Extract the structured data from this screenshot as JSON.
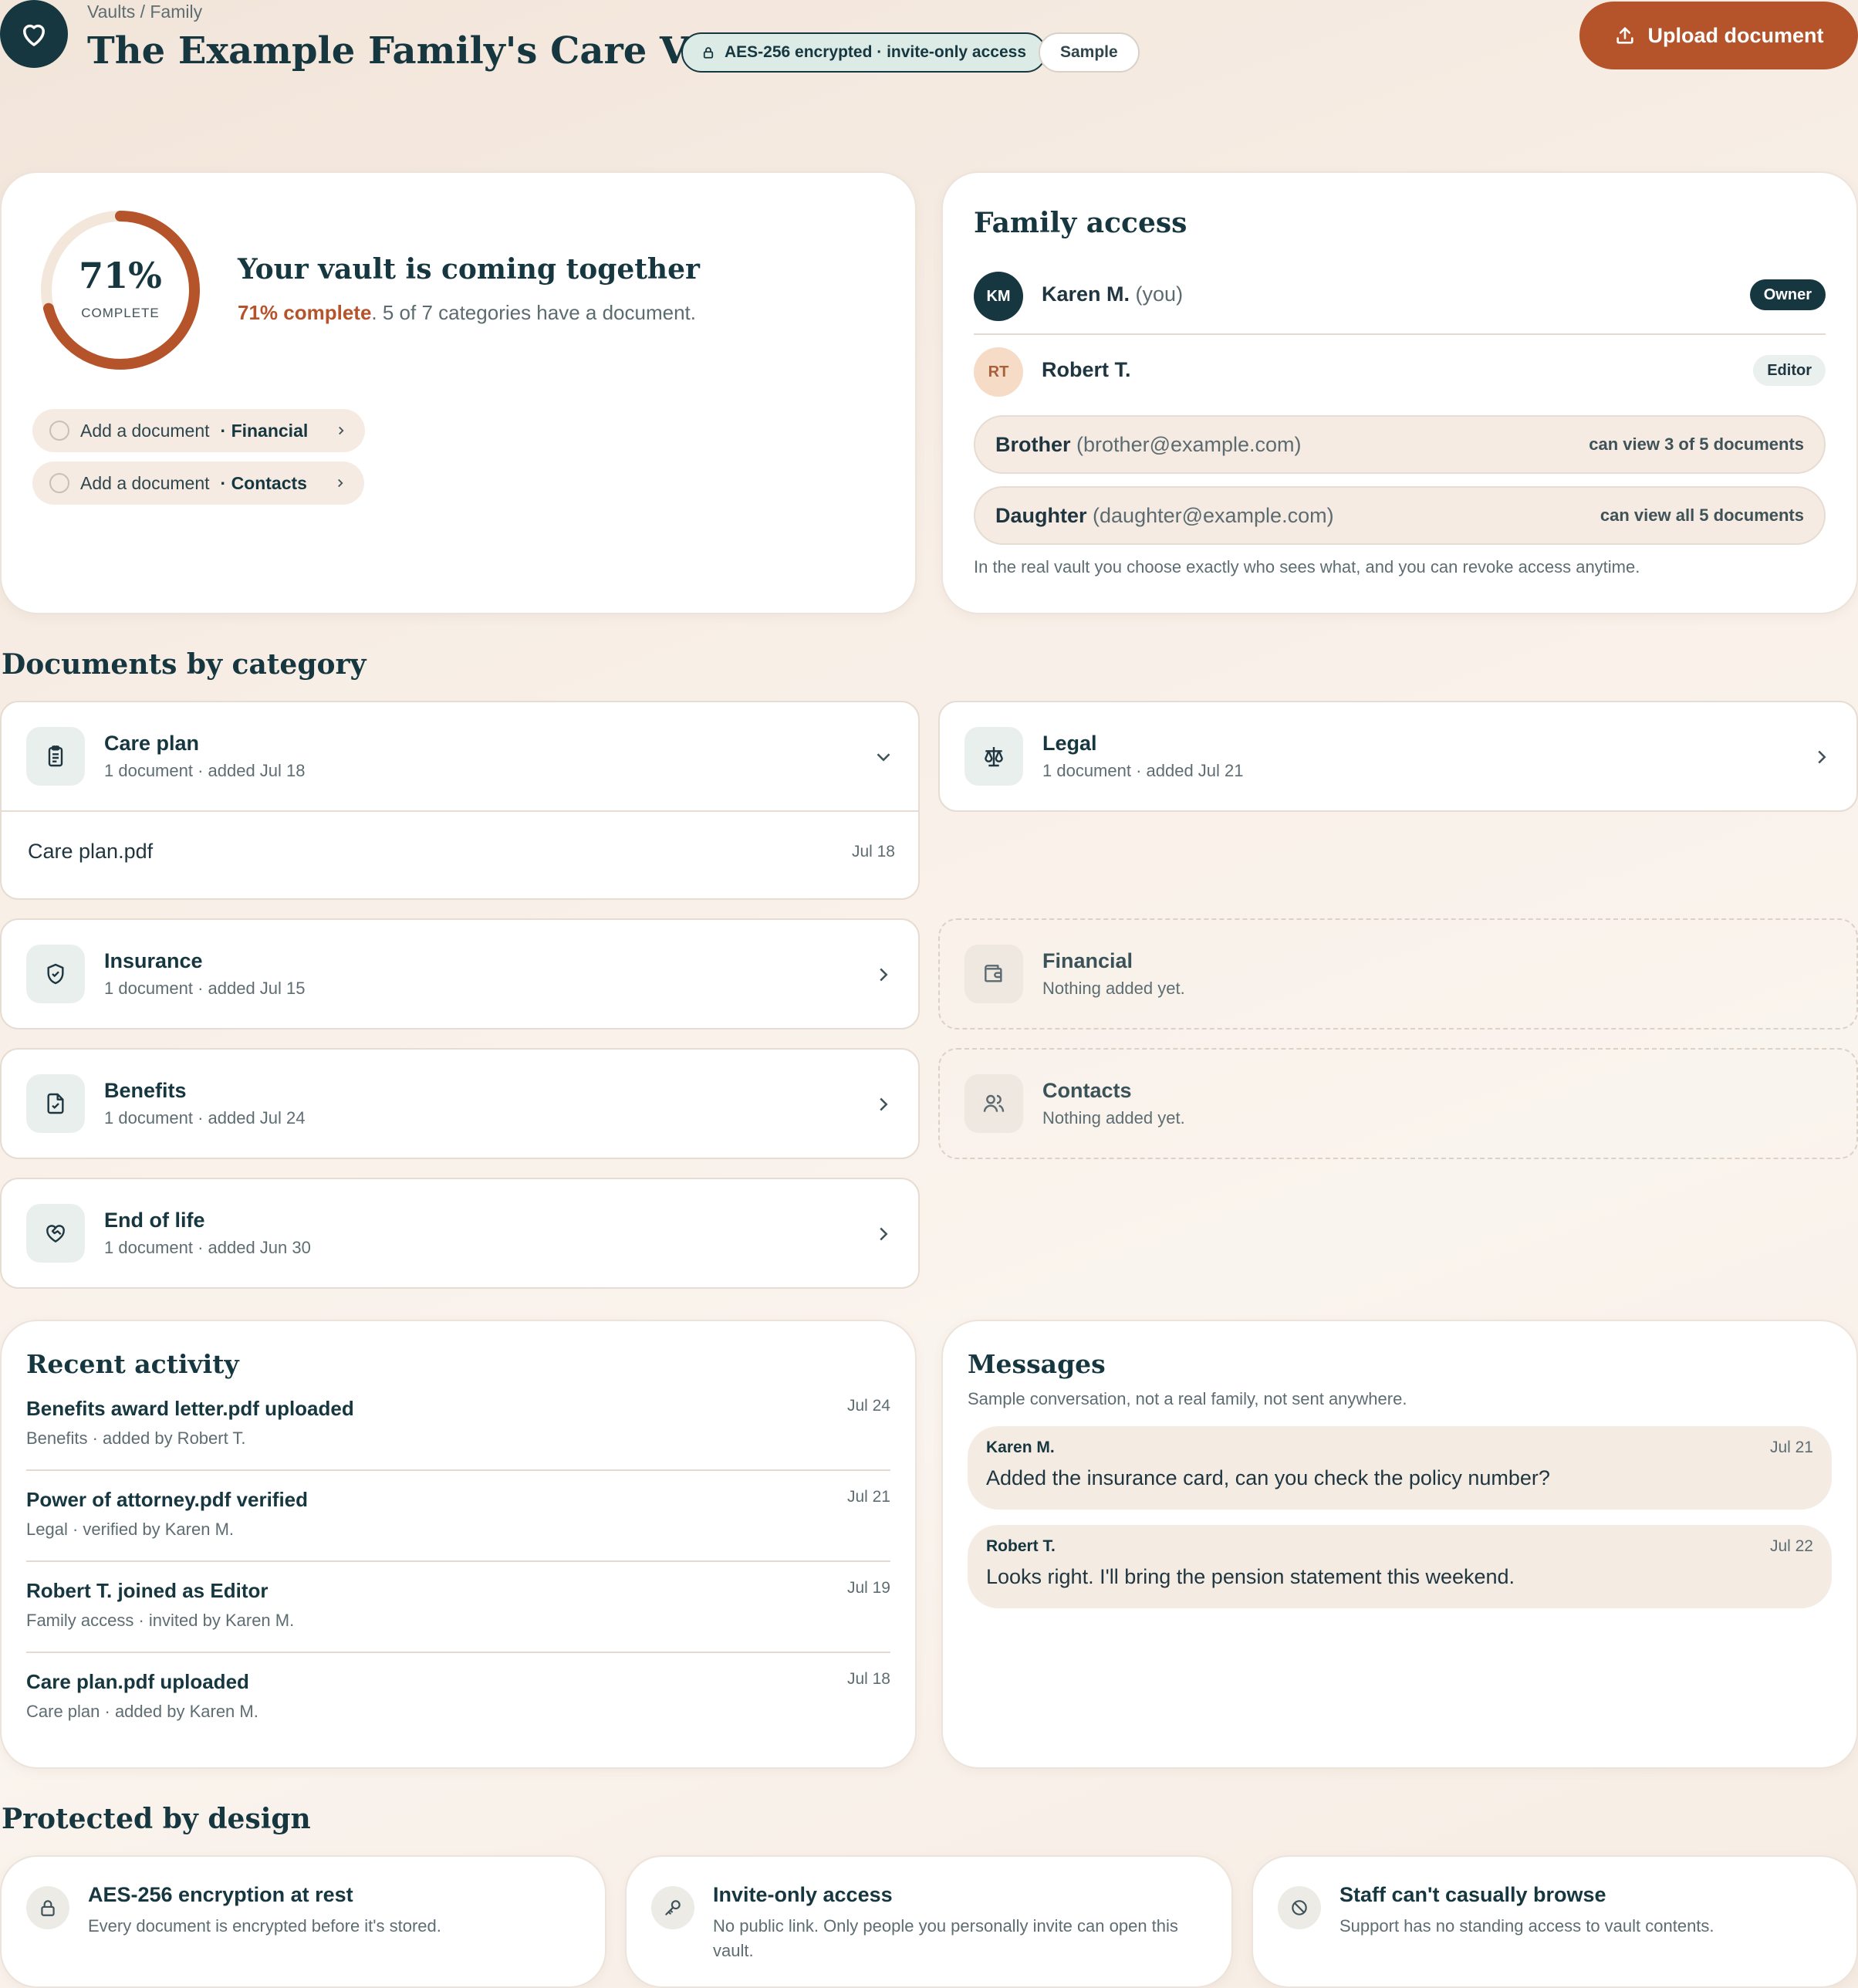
{
  "header": {
    "breadcrumb": "Vaults / Family",
    "title": "The Example Family's Care Vault",
    "encryption_badge": "AES-256 encrypted · invite-only access",
    "sample_badge": "Sample",
    "upload_label": "Upload document"
  },
  "progress": {
    "percent": 71,
    "percent_label": "71%",
    "complete_label": "COMPLETE",
    "heading": "Your vault is coming together",
    "summary_strong": "71% complete",
    "summary_rest": ". 5 of 7 categories have a document.",
    "todos": [
      {
        "label": "Add a document",
        "category": "· Financial"
      },
      {
        "label": "Add a document",
        "category": "· Contacts"
      }
    ]
  },
  "family_access": {
    "title": "Family access",
    "members": [
      {
        "initials": "KM",
        "name": "Karen M.",
        "note": "(you)",
        "role": "Owner"
      },
      {
        "initials": "RT",
        "name": "Robert T.",
        "note": "",
        "role": "Editor"
      }
    ],
    "viewers": [
      {
        "name": "Brother",
        "email": "(brother@example.com)",
        "permission": "can view 3 of 5 documents"
      },
      {
        "name": "Daughter",
        "email": "(daughter@example.com)",
        "permission": "can view all 5 documents"
      }
    ],
    "footnote": "In the real vault you choose exactly who sees what, and you can revoke access anytime."
  },
  "documents": {
    "title": "Documents by category",
    "categories": [
      {
        "name": "Care plan",
        "sub": "1 document · added Jul 18",
        "icon": "clipboard-icon",
        "expanded": true,
        "files": [
          {
            "name": "Care plan.pdf",
            "date": "Jul 18"
          }
        ]
      },
      {
        "name": "Legal",
        "sub": "1 document · added Jul 21",
        "icon": "scale-icon"
      },
      {
        "name": "Insurance",
        "sub": "1 document · added Jul 15",
        "icon": "shield-icon"
      },
      {
        "name": "Financial",
        "sub": "Nothing added yet.",
        "icon": "wallet-icon",
        "empty": true
      },
      {
        "name": "Benefits",
        "sub": "1 document · added Jul 24",
        "icon": "file-check-icon"
      },
      {
        "name": "Contacts",
        "sub": "Nothing added yet.",
        "icon": "users-icon",
        "empty": true
      },
      {
        "name": "End of life",
        "sub": "1 document · added Jun 30",
        "icon": "heart-handshake-icon"
      }
    ]
  },
  "activity": {
    "title": "Recent activity",
    "items": [
      {
        "title": "Benefits award letter.pdf uploaded",
        "sub": "Benefits · added by Robert T.",
        "date": "Jul 24"
      },
      {
        "title": "Power of attorney.pdf verified",
        "sub": "Legal · verified by Karen M.",
        "date": "Jul 21"
      },
      {
        "title": "Robert T. joined as Editor",
        "sub": "Family access · invited by Karen M.",
        "date": "Jul 19"
      },
      {
        "title": "Care plan.pdf uploaded",
        "sub": "Care plan · added by Karen M.",
        "date": "Jul 18"
      }
    ]
  },
  "messages": {
    "title": "Messages",
    "note": "Sample conversation, not a real family, not sent anywhere.",
    "items": [
      {
        "from": "Karen M.",
        "date": "Jul 21",
        "text": "Added the insurance card, can you check the policy number?"
      },
      {
        "from": "Robert T.",
        "date": "Jul 22",
        "text": "Looks right. I'll bring the pension statement this weekend."
      }
    ]
  },
  "protected": {
    "title": "Protected by design",
    "items": [
      {
        "title": "AES-256 encryption at rest",
        "sub": "Every document is encrypted before it's stored.",
        "icon": "lock-icon"
      },
      {
        "title": "Invite-only access",
        "sub": "No public link. Only people you personally invite can open this vault.",
        "icon": "key-icon"
      },
      {
        "title": "Staff can't casually browse",
        "sub": "Support has no standing access to vault contents.",
        "icon": "ban-icon"
      }
    ]
  },
  "colors": {
    "brand_dark": "#16373f",
    "accent": "#b5532b",
    "card": "#ffffff",
    "background": "#f8efe7"
  }
}
